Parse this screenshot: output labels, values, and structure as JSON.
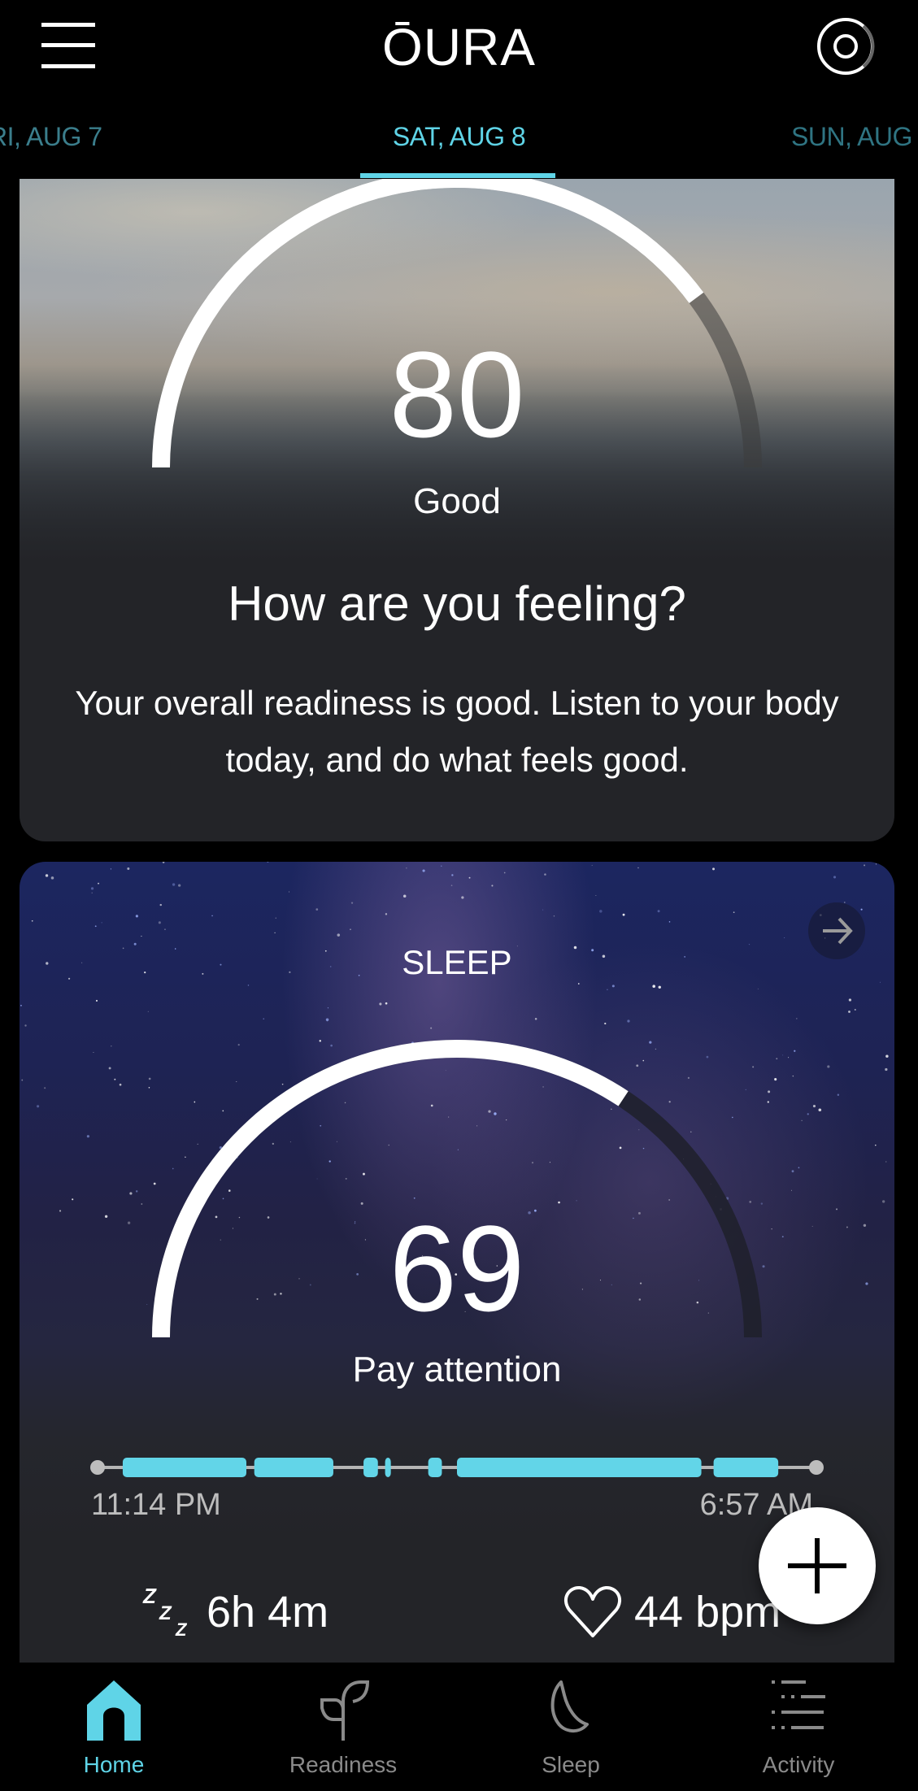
{
  "header": {
    "logo_text": "ŌURA",
    "menu_icon": "hamburger-menu-icon",
    "ring_icon": "ring-icon"
  },
  "date_tabs": {
    "previous": "RI, AUG 7",
    "current": "SAT, AUG 8",
    "next": "SUN, AUG",
    "active_color": "#5fd4e7"
  },
  "readiness": {
    "score": "80",
    "score_value": 80,
    "score_max": 100,
    "label": "Good",
    "title": "How are you feeling?",
    "body": "Your overall readiness is good. Listen to your body today, and do what feels good."
  },
  "sleep": {
    "title": "SLEEP",
    "score": "69",
    "score_value": 69,
    "score_max": 100,
    "label": "Pay attention",
    "start_time": "11:14 PM",
    "end_time": "6:57 AM",
    "hypnogram_segments": [
      {
        "start": 0.035,
        "end": 0.207
      },
      {
        "start": 0.218,
        "end": 0.328
      },
      {
        "start": 0.37,
        "end": 0.39
      },
      {
        "start": 0.4,
        "end": 0.408
      },
      {
        "start": 0.46,
        "end": 0.479
      },
      {
        "start": 0.5,
        "end": 0.84
      },
      {
        "start": 0.857,
        "end": 0.947
      }
    ],
    "duration": "6h 4m",
    "heart_rate": "44 bpm",
    "duration_icon": "zzz-icon",
    "heart_icon": "heart-icon",
    "accent_color": "#62d5e8"
  },
  "fab": {
    "icon": "plus-icon"
  },
  "bottom_nav": {
    "items": [
      {
        "label": "Home",
        "icon": "home-icon",
        "active": true
      },
      {
        "label": "Readiness",
        "icon": "sprout-icon",
        "active": false
      },
      {
        "label": "Sleep",
        "icon": "moon-icon",
        "active": false
      },
      {
        "label": "Activity",
        "icon": "activity-list-icon",
        "active": false
      }
    ]
  }
}
